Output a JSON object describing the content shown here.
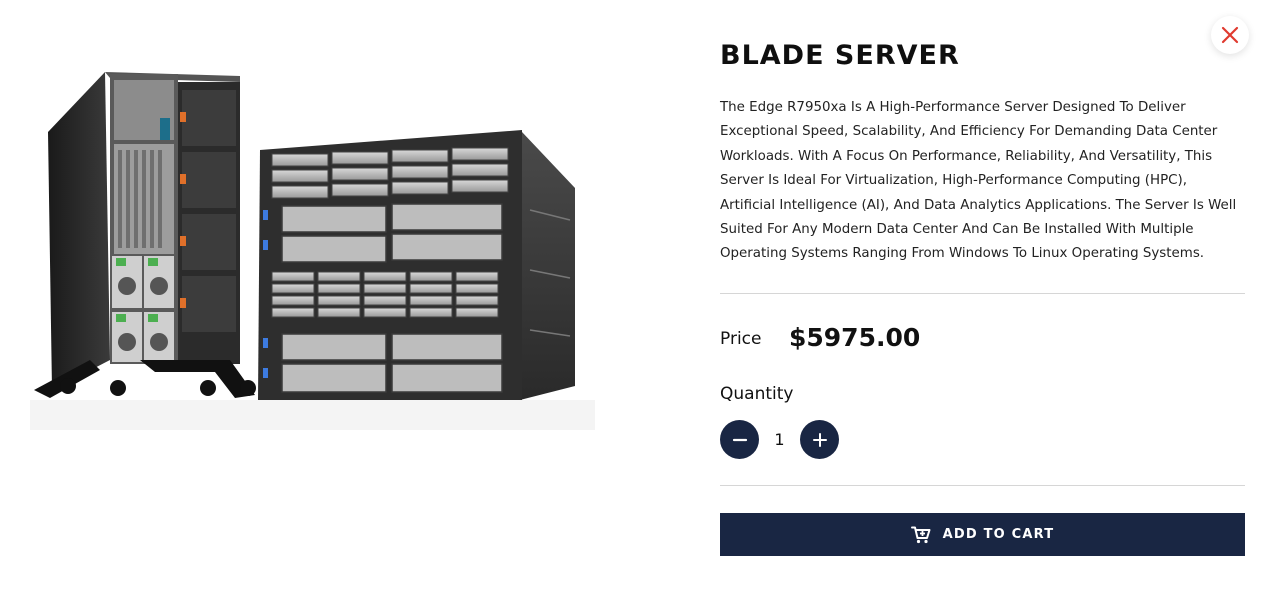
{
  "product": {
    "title": "BLADE SERVER",
    "description": "The Edge R7950xa Is A High-Performance Server Designed To Deliver Exceptional Speed, Scalability, And Efficiency For Demanding Data Center Workloads. With A Focus On Performance, Reliability, And Versatility, This Server Is Ideal For Virtualization, High-Performance Computing (HPC), Artificial Intelligence (AI), And Data Analytics Applications. The Server Is Well Suited For Any Modern Data Center And Can Be Installed With Multiple Operating Systems Ranging From Windows To Linux Operating Systems.",
    "price_label": "Price",
    "price_value": "$5975.00",
    "quantity_label": "Quantity",
    "quantity_value": "1"
  },
  "actions": {
    "add_to_cart_label": "ADD TO CART"
  },
  "icons": {
    "close": "close-icon",
    "minus": "minus-icon",
    "plus": "plus-icon",
    "cart": "cart-icon"
  },
  "colors": {
    "primary": "#192643",
    "close_accent": "#e03a2f",
    "divider": "#d6d6d6"
  }
}
